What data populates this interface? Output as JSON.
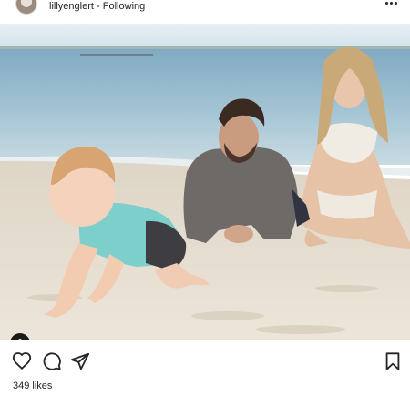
{
  "header": {
    "username": "lillyenglert",
    "separator": "•",
    "follow_status": "Following",
    "avatar_icon": "profile-avatar",
    "more_icon": "more-options-icon"
  },
  "photo": {
    "user_tag_icon": "user-tag-icon"
  },
  "actions": {
    "like_icon": "heart-icon",
    "comment_icon": "comment-icon",
    "share_icon": "share-icon",
    "save_icon": "bookmark-icon"
  },
  "likes": {
    "text": "349 likes"
  },
  "colors": {
    "text": "#262626",
    "muted": "#8e8e8e",
    "sky": "#dfeaf2",
    "sea": "#8fb6cc",
    "sand": "#e9e1d4"
  }
}
